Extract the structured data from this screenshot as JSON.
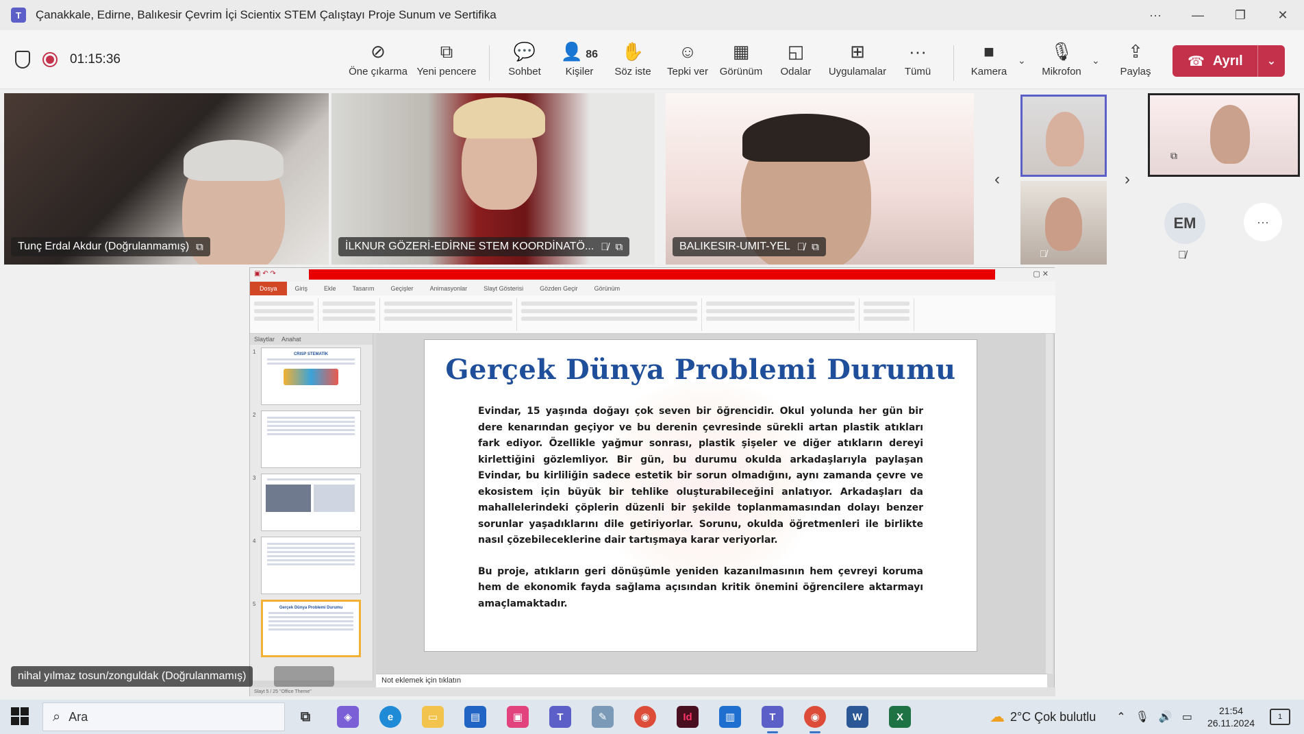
{
  "window": {
    "title": "Çanakkale, Edirne, Balıkesir Çevrim İçi Scientix STEM Çalıştayı Proje Sunum ve Sertifika",
    "controls": [
      "···",
      "—",
      "❐",
      "✕"
    ]
  },
  "toolbar": {
    "timer": "01:15:36",
    "buttons": [
      {
        "label": "Öne çıkarma",
        "icon": "no-spotlight-icon"
      },
      {
        "label": "Yeni pencere",
        "icon": "new-window-icon"
      },
      {
        "label": "Sohbet",
        "icon": "chat-icon"
      },
      {
        "label": "Kişiler",
        "icon": "people-icon",
        "count": "86"
      },
      {
        "label": "Söz iste",
        "icon": "raise-hand-icon"
      },
      {
        "label": "Tepki ver",
        "icon": "smiley-icon"
      },
      {
        "label": "Görünüm",
        "icon": "grid-icon"
      },
      {
        "label": "Odalar",
        "icon": "rooms-icon"
      },
      {
        "label": "Uygulamalar",
        "icon": "add-apps-icon"
      },
      {
        "label": "Tümü",
        "icon": "more-icon"
      },
      {
        "label": "Kamera",
        "icon": "camera-icon"
      },
      {
        "label": "Mikrofon",
        "icon": "microphone-icon"
      },
      {
        "label": "Paylaş",
        "icon": "share-icon"
      }
    ],
    "leave_label": "Ayrıl",
    "leave_color": "#c4314b"
  },
  "participants": {
    "tile1": "Tunç Erdal Akdur (Doğrulanmamış)",
    "tile2": "İLKNUR GÖZERİ-EDİRNE STEM KOORDİNATÖ...",
    "tile3": "BALIKESIR-UMIT-YEL",
    "avatar_initials": "EM",
    "presenter_caption": "nihal yılmaz tosun/zonguldak (Doğrulanmamış)"
  },
  "powerpoint": {
    "tabs": [
      "Dosya",
      "Giriş",
      "Ekle",
      "Tasarım",
      "Geçişler",
      "Animasyonlar",
      "Slayt Gösterisi",
      "Gözden Geçir",
      "Görünüm"
    ],
    "side_tabs": [
      "Slaytlar",
      "Anahat"
    ],
    "thumb1_title": "CRISP STEMATİK",
    "thumb5_title": "Gerçek Dünya Problemi Durumu",
    "slide": {
      "title": "Gerçek Dünya Problemi Durumu",
      "paragraph1": "Evindar, 15 yaşında doğayı çok seven bir öğrencidir. Okul yolunda her gün bir dere kenarından geçiyor ve bu derenin çevresinde sürekli artan plastik atıkları fark ediyor. Özellikle yağmur sonrası, plastik şişeler ve diğer atıkların dereyi kirlettiğini gözlemliyor. Bir gün, bu durumu okulda arkadaşlarıyla paylaşan Evindar, bu kirliliğin sadece estetik bir sorun olmadığını, aynı zamanda çevre ve ekosistem için büyük bir tehlike oluşturabileceğini anlatıyor. Arkadaşları da mahallelerindeki çöplerin düzenli bir şekilde toplanmamasından dolayı benzer sorunlar yaşadıklarını dile getiriyorlar. Sorunu, okulda öğretmenleri ile birlikte nasıl çözebileceklerine dair tartışmaya karar veriyorlar.",
      "paragraph2": "Bu proje, atıkların geri dönüşümle yeniden kazanılmasının hem çevreyi koruma hem de ekonomik fayda sağlama açısından kritik önemini öğrencilere aktarmayı amaçlamaktadır."
    },
    "notes_placeholder": "Not eklemek için tıklatın",
    "status": "Slayt 5 / 25   \"Office Theme\""
  },
  "taskbar": {
    "search_label": "Ara",
    "weather": "2°C  Çok bulutlu",
    "time": "21:54",
    "date": "26.11.2024",
    "notification_count": "1"
  }
}
